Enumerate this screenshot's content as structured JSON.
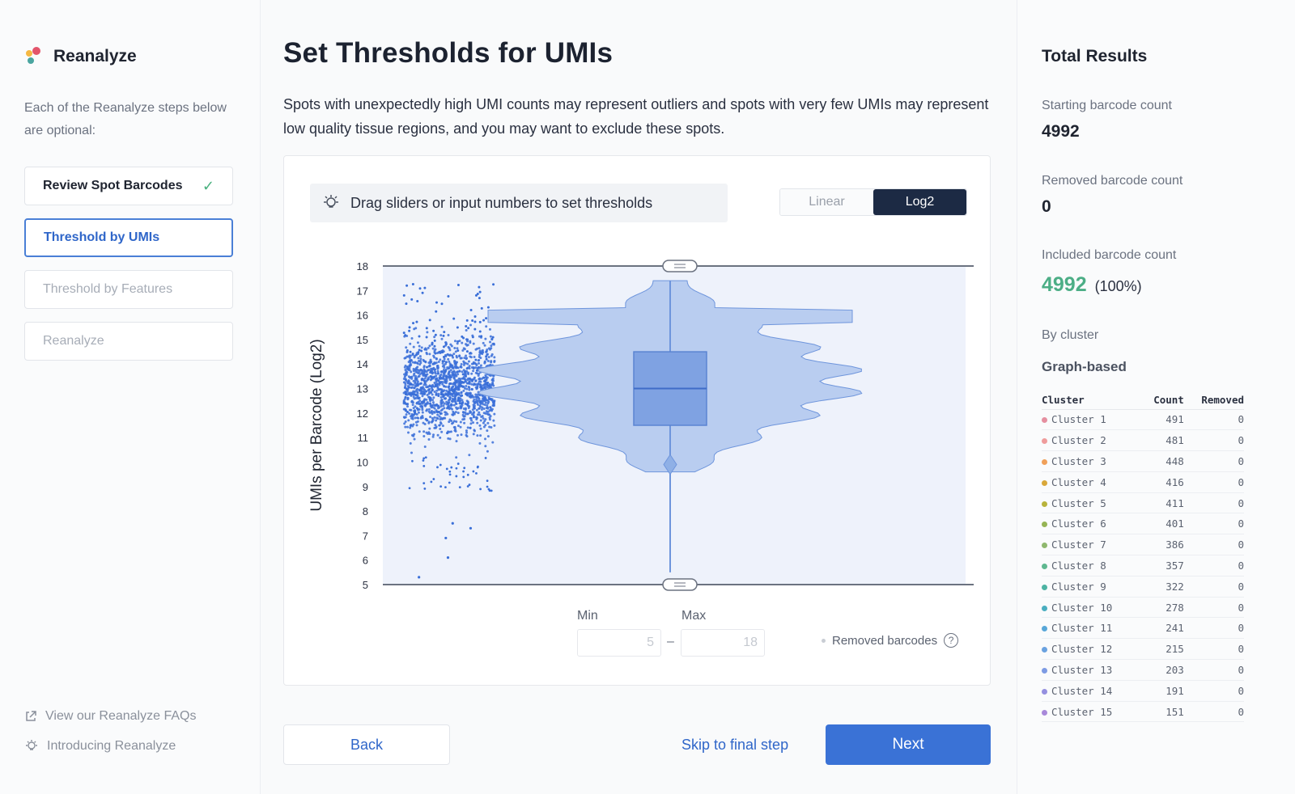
{
  "sidebar": {
    "brand": "Reanalyze",
    "description": "Each of the Reanalyze steps below are optional:",
    "steps": [
      {
        "label": "Review Spot Barcodes",
        "state": "done"
      },
      {
        "label": "Threshold by UMIs",
        "state": "active"
      },
      {
        "label": "Threshold by Features",
        "state": "pending"
      },
      {
        "label": "Reanalyze",
        "state": "pending"
      }
    ],
    "links": [
      {
        "label": "View our Reanalyze FAQs",
        "icon": "external-link-icon"
      },
      {
        "label": "Introducing Reanalyze",
        "icon": "lightbulb-icon"
      }
    ]
  },
  "main": {
    "title": "Set Thresholds for UMIs",
    "description": "Spots with unexpectedly high UMI counts may represent outliers and spots with very few UMIs may represent low quality tissue regions, and you may want to exclude these spots.",
    "hint": "Drag sliders or input numbers to set thresholds",
    "scale_options": [
      "Linear",
      "Log2"
    ],
    "scale_selected": "Log2",
    "min_label": "Min",
    "max_label": "Max",
    "min_value": "5",
    "max_value": "18",
    "removed_legend": "Removed barcodes",
    "back_label": "Back",
    "skip_label": "Skip to final step",
    "next_label": "Next"
  },
  "chart_data": {
    "type": "scatter",
    "ylabel": "UMIs per Barcode (Log2)",
    "yticks": [
      5,
      6,
      7,
      8,
      9,
      10,
      11,
      12,
      13,
      14,
      15,
      16,
      17,
      18
    ],
    "ylim": [
      5,
      18
    ],
    "threshold_min": 5,
    "threshold_max": 18,
    "box": {
      "q1": 11.5,
      "median": 13.0,
      "q3": 14.5,
      "whisker_low": 5.5,
      "whisker_high": 17.4
    },
    "outliers_low": [
      5.3,
      6.1,
      6.9,
      7.3,
      7.5
    ]
  },
  "colors": {
    "accent": "#3a72d6",
    "points": "#3a6fd8",
    "violin": "#b9cdf0",
    "plot_bg": "#eef2fb",
    "included": "#4cae86"
  },
  "results": {
    "title": "Total Results",
    "starting_label": "Starting barcode count",
    "starting_value": "4992",
    "removed_label": "Removed barcode count",
    "removed_value": "0",
    "included_label": "Included barcode count",
    "included_value": "4992",
    "included_pct": "(100%)",
    "by_cluster_label": "By cluster",
    "graph_label": "Graph-based",
    "table_headers": [
      "Cluster",
      "Count",
      "Removed"
    ],
    "clusters": [
      {
        "name": "Cluster 1",
        "count": "491",
        "removed": "0",
        "color": "#e58fa0"
      },
      {
        "name": "Cluster 2",
        "count": "481",
        "removed": "0",
        "color": "#ef9c9c"
      },
      {
        "name": "Cluster 3",
        "count": "448",
        "removed": "0",
        "color": "#f0a05a"
      },
      {
        "name": "Cluster 4",
        "count": "416",
        "removed": "0",
        "color": "#d9a83a"
      },
      {
        "name": "Cluster 5",
        "count": "411",
        "removed": "0",
        "color": "#b8b33c"
      },
      {
        "name": "Cluster 6",
        "count": "401",
        "removed": "0",
        "color": "#96b455"
      },
      {
        "name": "Cluster 7",
        "count": "386",
        "removed": "0",
        "color": "#8fb86e"
      },
      {
        "name": "Cluster 8",
        "count": "357",
        "removed": "0",
        "color": "#5fb890"
      },
      {
        "name": "Cluster 9",
        "count": "322",
        "removed": "0",
        "color": "#4db3a3"
      },
      {
        "name": "Cluster 10",
        "count": "278",
        "removed": "0",
        "color": "#4aaec0"
      },
      {
        "name": "Cluster 11",
        "count": "241",
        "removed": "0",
        "color": "#58a7d8"
      },
      {
        "name": "Cluster 12",
        "count": "215",
        "removed": "0",
        "color": "#6aa2e0"
      },
      {
        "name": "Cluster 13",
        "count": "203",
        "removed": "0",
        "color": "#7d9be4"
      },
      {
        "name": "Cluster 14",
        "count": "191",
        "removed": "0",
        "color": "#9590e0"
      },
      {
        "name": "Cluster 15",
        "count": "151",
        "removed": "0",
        "color": "#a889da"
      }
    ]
  }
}
